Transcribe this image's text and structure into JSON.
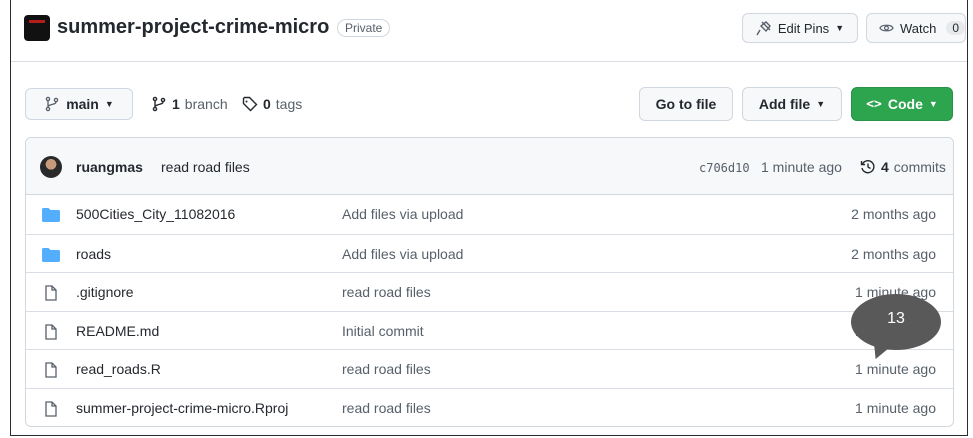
{
  "repo": {
    "name": "summer-project-crime-micro",
    "visibility": "Private"
  },
  "header_actions": {
    "pins_label": "Edit Pins",
    "watch_label": "Watch",
    "watch_count": "0"
  },
  "toolbar": {
    "branch_name": "main",
    "branch_count": "1",
    "branch_word": "branch",
    "tag_count": "0",
    "tag_word": "tags",
    "goto_label": "Go to file",
    "addfile_label": "Add file",
    "code_label": "Code"
  },
  "latest_commit": {
    "author": "ruangmas",
    "message": "read road files",
    "sha": "c706d10",
    "time": "1 minute ago",
    "commit_count": "4",
    "commit_word": "commits"
  },
  "files": [
    {
      "type": "folder",
      "name": "500Cities_City_11082016",
      "commit": "Add files via upload",
      "age": "2 months ago"
    },
    {
      "type": "folder",
      "name": "roads",
      "commit": "Add files via upload",
      "age": "2 months ago"
    },
    {
      "type": "file",
      "name": ".gitignore",
      "commit": "read road files",
      "age": "1 minute ago"
    },
    {
      "type": "file",
      "name": "README.md",
      "commit": "Initial commit",
      "age": "1 minute ago"
    },
    {
      "type": "file",
      "name": "read_roads.R",
      "commit": "read road files",
      "age": "1 minute ago"
    },
    {
      "type": "file",
      "name": "summer-project-crime-micro.Rproj",
      "commit": "read road files",
      "age": "1 minute ago"
    }
  ],
  "overlay": {
    "bubble_number": "13"
  },
  "colors": {
    "code_button": "#2da44e",
    "folder_icon": "#54aeff",
    "bubble": "#595959"
  }
}
